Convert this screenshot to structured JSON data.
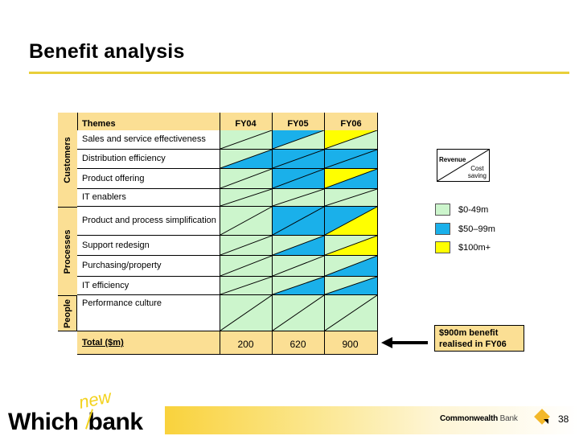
{
  "title": "Benefit analysis",
  "colors": {
    "band_0_49": "#ccf5cc",
    "band_50_99": "#1ab0ea",
    "band_100_plus": "#ffff00",
    "header_fill": "#fbdf94",
    "title_rule": "#e8cf3a"
  },
  "table": {
    "header": {
      "themes": "Themes",
      "years": [
        "FY04",
        "FY05",
        "FY06"
      ]
    },
    "groups": [
      {
        "label": "Customers",
        "rows": [
          0,
          1,
          2,
          3
        ]
      },
      {
        "label": "Processes",
        "rows": [
          4,
          5,
          6,
          7
        ]
      },
      {
        "label": "People",
        "rows": [
          8
        ]
      }
    ],
    "rows": [
      {
        "theme": "Sales and service effectiveness",
        "cells": [
          {
            "revenue": "0-49",
            "cost": "0-49"
          },
          {
            "revenue": "50-99",
            "cost": "0-49"
          },
          {
            "revenue": "100+",
            "cost": "0-49"
          }
        ]
      },
      {
        "theme": "Distribution efficiency",
        "cells": [
          {
            "revenue": "0-49",
            "cost": "50-99"
          },
          {
            "revenue": "50-99",
            "cost": "50-99"
          },
          {
            "revenue": "50-99",
            "cost": "50-99"
          }
        ]
      },
      {
        "theme": "Product offering",
        "cells": [
          {
            "revenue": "0-49",
            "cost": "0-49"
          },
          {
            "revenue": "50-99",
            "cost": "50-99"
          },
          {
            "revenue": "100+",
            "cost": "50-99"
          }
        ]
      },
      {
        "theme": "IT enablers",
        "cells": [
          {
            "revenue": "0-49",
            "cost": "0-49"
          },
          {
            "revenue": "0-49",
            "cost": "0-49"
          },
          {
            "revenue": "0-49",
            "cost": "0-49"
          }
        ]
      },
      {
        "theme": "Product and process simplification",
        "cells": [
          {
            "revenue": "0-49",
            "cost": "0-49"
          },
          {
            "revenue": "50-99",
            "cost": "50-99"
          },
          {
            "revenue": "50-99",
            "cost": "100+"
          }
        ]
      },
      {
        "theme": "Support redesign",
        "cells": [
          {
            "revenue": "0-49",
            "cost": "0-49"
          },
          {
            "revenue": "0-49",
            "cost": "50-99"
          },
          {
            "revenue": "0-49",
            "cost": "100+"
          }
        ]
      },
      {
        "theme": "Purchasing/property",
        "cells": [
          {
            "revenue": "0-49",
            "cost": "0-49"
          },
          {
            "revenue": "0-49",
            "cost": "0-49"
          },
          {
            "revenue": "0-49",
            "cost": "50-99"
          }
        ]
      },
      {
        "theme": "IT efficiency",
        "cells": [
          {
            "revenue": "0-49",
            "cost": "0-49"
          },
          {
            "revenue": "0-49",
            "cost": "50-99"
          },
          {
            "revenue": "0-49",
            "cost": "50-99"
          }
        ]
      },
      {
        "theme": "Performance culture",
        "cells": [
          {
            "revenue": "0-49",
            "cost": "0-49"
          },
          {
            "revenue": "0-49",
            "cost": "0-49"
          },
          {
            "revenue": "0-49",
            "cost": "0-49"
          }
        ]
      }
    ],
    "total": {
      "label": "Total ($m)",
      "values": [
        "200",
        "620",
        "900"
      ]
    }
  },
  "legend": {
    "split_revenue": "Revenue",
    "split_cost": "Cost saving",
    "bands": [
      {
        "key": "0-49",
        "label": "$0-49m"
      },
      {
        "key": "50-99",
        "label": "$50–99m"
      },
      {
        "key": "100+",
        "label": "$100m+"
      }
    ]
  },
  "callout": "$900m benefit realised in FY06",
  "footer": {
    "logo_main_left": "Which",
    "logo_main_right": "bank",
    "logo_accent": "new",
    "brand_bold": "Commonwealth",
    "brand_light": "Bank",
    "page_number": "38"
  }
}
